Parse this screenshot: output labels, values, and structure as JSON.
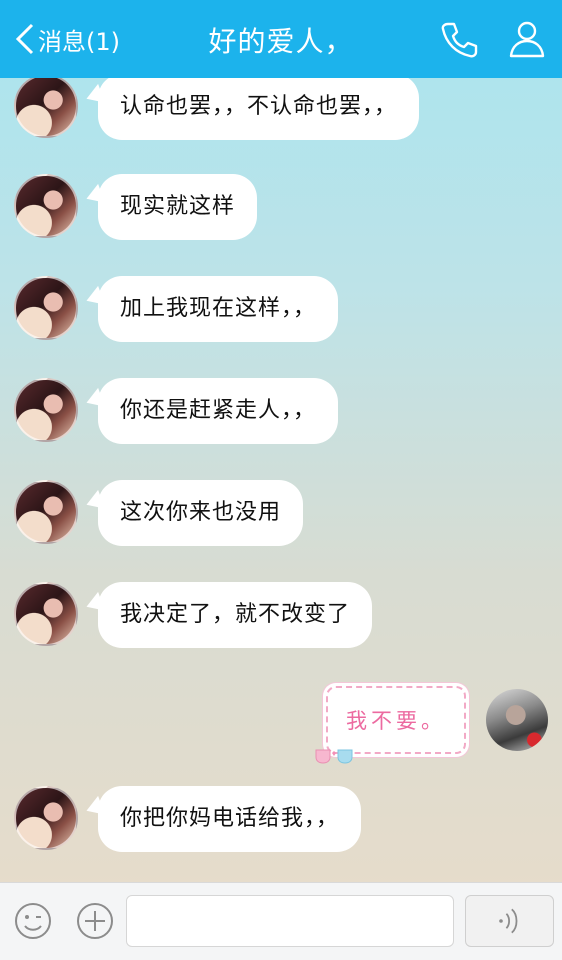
{
  "header": {
    "back_label": "消息(1)",
    "title": "好的爱人，",
    "icons": [
      "back-chevron-icon",
      "phone-icon",
      "profile-icon"
    ]
  },
  "messages": [
    {
      "from": "other",
      "text": "认命也罢，，不认命也罢，，"
    },
    {
      "from": "other",
      "text": "现实就这样"
    },
    {
      "from": "other",
      "text": "加上我现在这样，，"
    },
    {
      "from": "other",
      "text": "你还是赶紧走人，，"
    },
    {
      "from": "other",
      "text": "这次你来也没用"
    },
    {
      "from": "other",
      "text": "我决定了，就不改变了"
    },
    {
      "from": "self",
      "sticker_text": "我不要。"
    },
    {
      "from": "other",
      "text": "你把你妈电话给我，，"
    }
  ],
  "input_bar": {
    "placeholder": "",
    "icons": [
      "emoji-icon",
      "plus-icon",
      "voice-icon"
    ]
  },
  "colors": {
    "header": "#1cb3ec",
    "bubble": "#ffffff",
    "sticker_text": "#ec6aa0"
  }
}
